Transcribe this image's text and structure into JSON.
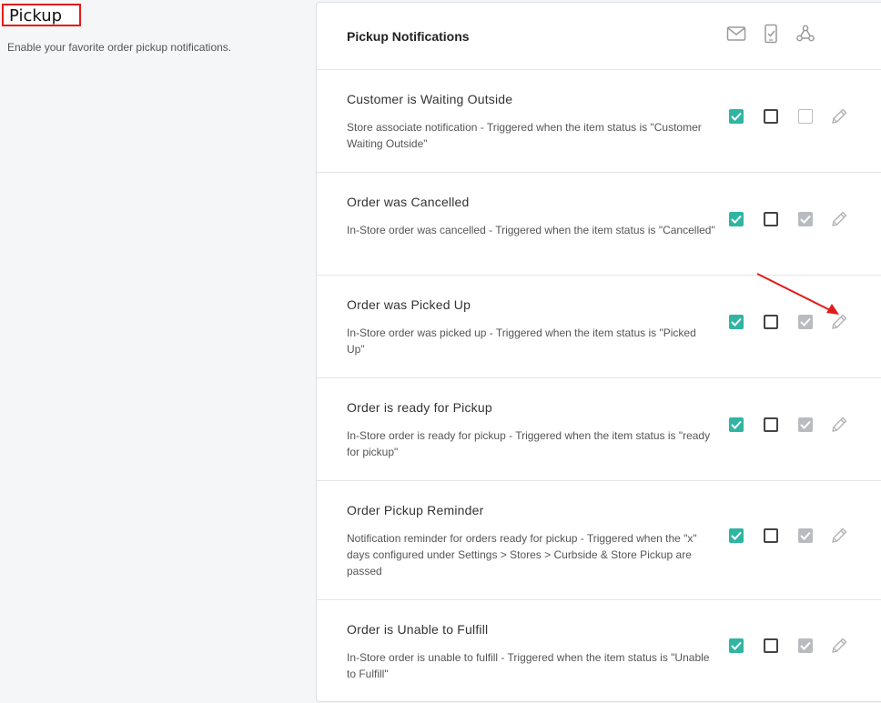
{
  "left": {
    "title": "Pickup",
    "subtitle": "Enable your favorite order pickup notifications."
  },
  "card": {
    "title": "Pickup Notifications",
    "header_icons": [
      "email-icon",
      "sms-phone-icon",
      "webhook-icon"
    ]
  },
  "rows": [
    {
      "title": "Customer is Waiting Outside",
      "desc": "Store associate notification - Triggered when the item status is \"Customer Waiting Outside\"",
      "email": "checked",
      "sms": "unchecked",
      "webhook": "unchecked-disabled"
    },
    {
      "title": "Order was Cancelled",
      "desc": "In-Store order was cancelled - Triggered when the item status is \"Cancelled\"",
      "email": "checked",
      "sms": "unchecked",
      "webhook": "checked-disabled"
    },
    {
      "title": "Order was Picked Up",
      "desc": "In-Store order was picked up - Triggered when the item status is \"Picked Up\"",
      "email": "checked",
      "sms": "unchecked",
      "webhook": "checked-disabled"
    },
    {
      "title": "Order is ready for Pickup",
      "desc": "In-Store order is ready for pickup - Triggered when the item status is \"ready for pickup\"",
      "email": "checked",
      "sms": "unchecked",
      "webhook": "checked-disabled"
    },
    {
      "title": "Order Pickup Reminder",
      "desc": "Notification reminder for orders ready for pickup - Triggered when the \"x\" days configured under Settings > Stores > Curbside & Store Pickup are passed",
      "email": "checked",
      "sms": "unchecked",
      "webhook": "checked-disabled"
    },
    {
      "title": "Order is Unable to Fulfill",
      "desc": "In-Store order is unable to fulfill - Triggered when the item status is \"Unable to Fulfill\"",
      "email": "checked",
      "sms": "unchecked",
      "webhook": "checked-disabled"
    }
  ],
  "colors": {
    "accent": "#2fb5a2",
    "disabled": "#b8bbbf",
    "highlight": "#e11b1b"
  }
}
